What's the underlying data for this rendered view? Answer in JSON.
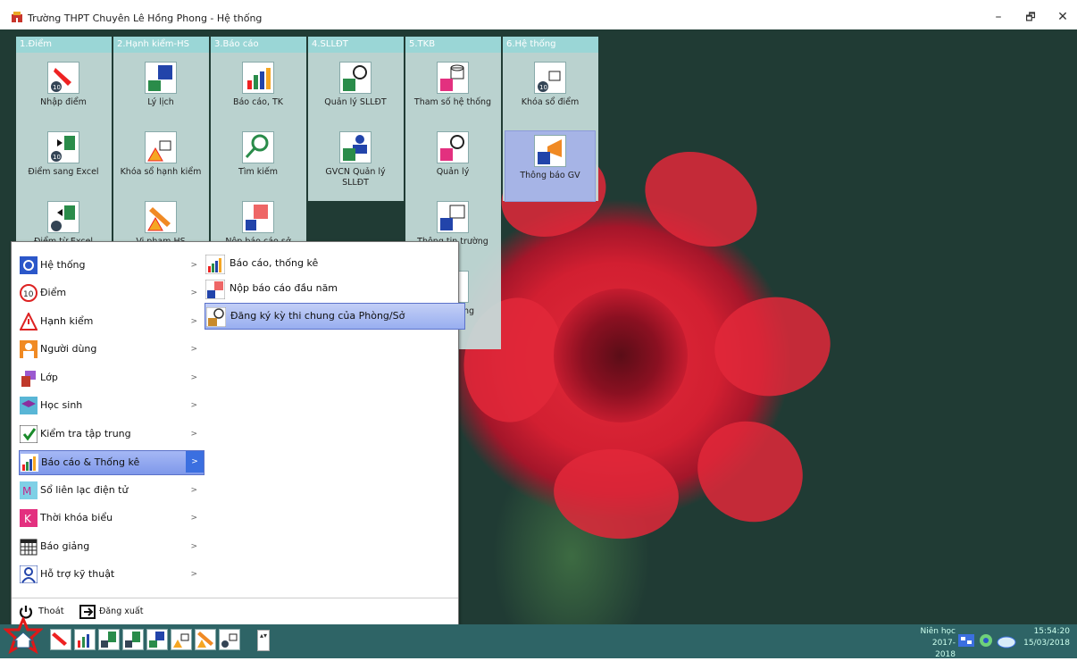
{
  "window": {
    "title": "Trường THPT Chuyên Lê Hồng Phong - Hệ thống",
    "minimize": "–",
    "restore": "🗗",
    "close": "✕"
  },
  "colors": {
    "tile_header": "#9ad6d6",
    "menu_highlight": "#7f98ea",
    "taskbar": "#2e6466"
  },
  "tile_columns": [
    {
      "header": "1.Điểm",
      "tiles": [
        "Nhập điểm",
        "Điểm sang Excel",
        "Điểm từ Excel"
      ]
    },
    {
      "header": "2.Hạnh kiểm-HS",
      "tiles": [
        "Lý lịch",
        "Khóa sổ hạnh kiểm",
        "Vi phạm HS"
      ]
    },
    {
      "header": "3.Báo cáo",
      "tiles": [
        "Báo cáo, TK",
        "Tìm kiếm",
        "Nộp báo cáo sở"
      ]
    },
    {
      "header": "4.SLLĐT",
      "tiles": [
        "Quản lý SLLĐT",
        "GVCN Quản lý SLLĐT"
      ]
    },
    {
      "header": "5.TKB",
      "tiles": [
        "Tham số hệ thống",
        "Quản lý",
        "Thông tin trường",
        "ng dẫn ng"
      ]
    },
    {
      "header": "6.Hệ thống",
      "tiles": [
        "Khóa sổ điểm",
        "Thông báo GV"
      ]
    }
  ],
  "menu": {
    "items": [
      {
        "label": "Hệ thống",
        "icon": "gear-icon"
      },
      {
        "label": "Điểm",
        "icon": "score-10-icon"
      },
      {
        "label": "Hạnh kiểm",
        "icon": "warning-icon"
      },
      {
        "label": "Người dùng",
        "icon": "user-icon"
      },
      {
        "label": "Lớp",
        "icon": "class-icon"
      },
      {
        "label": "Học sinh",
        "icon": "student-icon"
      },
      {
        "label": "Kiểm tra tập trung",
        "icon": "check-icon"
      },
      {
        "label": "Báo cáo & Thống kê",
        "icon": "chart-icon"
      },
      {
        "label": "Sổ liên lạc điện tử",
        "icon": "contact-book-icon"
      },
      {
        "label": "Thời khóa biểu",
        "icon": "timetable-icon"
      },
      {
        "label": "Báo giảng",
        "icon": "calendar-icon"
      },
      {
        "label": "Hỗ trợ kỹ thuật",
        "icon": "support-icon"
      }
    ],
    "arrow": ">",
    "submenu": [
      "Báo cáo, thống kê",
      "Nộp báo cáo đầu năm",
      "Đăng ký kỳ thi chung của Phòng/Sở"
    ],
    "exit_label": "Thoát",
    "logout_label": "Đăng xuất"
  },
  "taskbar": {
    "scroll_indicator": "▴▾",
    "school_year_label": "Niên học",
    "school_year": "2017-2018",
    "time": "15:54:20",
    "date": "15/03/2018"
  }
}
